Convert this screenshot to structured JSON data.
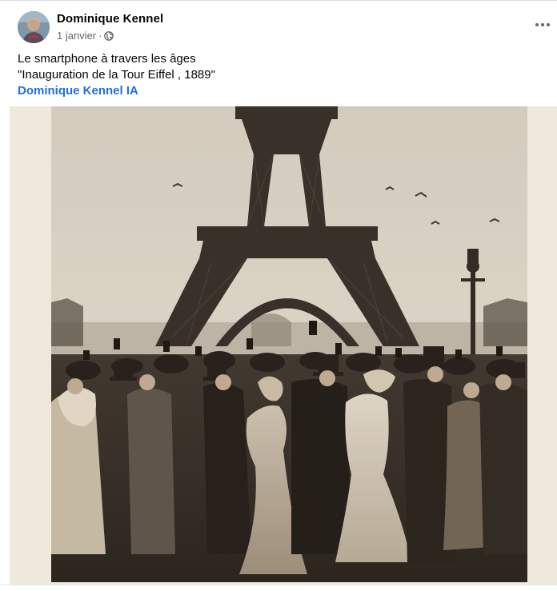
{
  "post": {
    "author": "Dominique Kennel",
    "date": "1 janvier",
    "separator": "·",
    "audience_icon": "globe-icon",
    "more_icon": "ellipsis-icon",
    "text_line1": "Le smartphone à travers les âges",
    "text_line2": "\"Inauguration de la Tour Eiffel , 1889\"",
    "link_text": "Dominique Kennel IA"
  },
  "colors": {
    "link": "#216fdb",
    "meta": "#65676b",
    "photo_tone": "sepia"
  }
}
